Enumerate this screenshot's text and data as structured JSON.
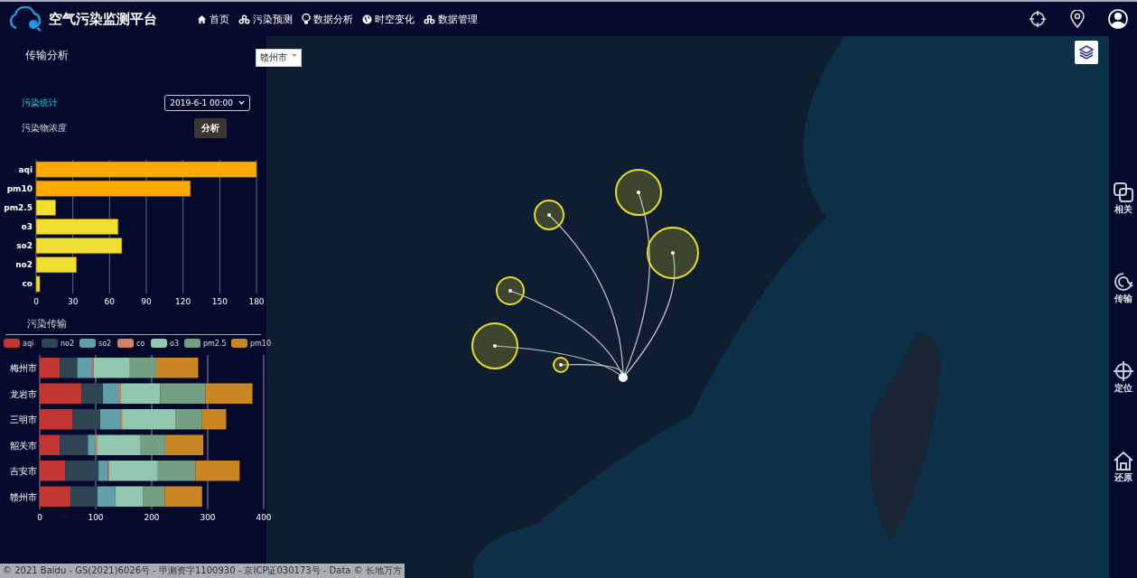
{
  "header": {
    "title": "空气污染监测平台",
    "nav": [
      {
        "label": "首页",
        "kind": "home"
      },
      {
        "label": "污染预测",
        "kind": "cluster"
      },
      {
        "label": "数据分析",
        "kind": "bulb"
      },
      {
        "label": "时空变化",
        "kind": "globe"
      },
      {
        "label": "数据管理",
        "kind": "cluster"
      }
    ]
  },
  "panel": {
    "title": "传输分析",
    "stats_label": "污染统计",
    "date_select": "2019-6-1 00:00",
    "concentration_label": "污染物浓度",
    "analyze_button": "分析",
    "chart_data": {
      "type": "bar",
      "orientation": "horizontal",
      "categories": [
        "aqi",
        "pm10",
        "pm2.5",
        "o3",
        "so2",
        "no2",
        "co"
      ],
      "values": [
        180,
        126,
        16,
        67,
        70,
        33,
        3
      ],
      "colors": [
        "#ffaa00",
        "#ffaa00",
        "#f0de30",
        "#f0de30",
        "#f0de30",
        "#f0de30",
        "#f0de30"
      ],
      "xlim": [
        0,
        180
      ],
      "xticks": [
        0,
        30,
        60,
        90,
        120,
        150,
        180
      ],
      "grid": true
    },
    "transport_title": "污染传输",
    "transport_chart": {
      "chart_data": {
        "type": "bar",
        "orientation": "horizontal",
        "stacked": true,
        "categories": [
          "梅州市",
          "龙岩市",
          "三明市",
          "韶关市",
          "吉安市",
          "赣州市"
        ],
        "xlim": [
          0,
          400
        ],
        "xticks": [
          0,
          100,
          200,
          300,
          400
        ],
        "grid": true,
        "legend": true,
        "series": [
          {
            "name": "aqi",
            "color": "#c23531",
            "values": [
              36,
              75,
              59,
              36,
              46,
              55
            ]
          },
          {
            "name": "no2",
            "color": "#2f4554",
            "values": [
              31,
              38,
              49,
              50,
              59,
              48
            ]
          },
          {
            "name": "so2",
            "color": "#61a0a8",
            "values": [
              27,
              29,
              37,
              13,
              17,
              32
            ]
          },
          {
            "name": "co",
            "color": "#d48265",
            "values": [
              2,
              3,
              2,
              3,
              2,
              null
            ]
          },
          {
            "name": "o3",
            "color": "#91c7ae",
            "values": [
              65,
              70,
              96,
              77,
              87,
              49
            ]
          },
          {
            "name": "pm2.5",
            "color": "#749f83",
            "values": [
              47,
              81,
              47,
              45,
              67,
              39
            ]
          },
          {
            "name": "pm10",
            "color": "#ca8622",
            "values": [
              75,
              84,
              43,
              68,
              79,
              67
            ]
          }
        ]
      }
    }
  },
  "map": {
    "city_select": "赣州市",
    "copyright": "© 2021 Baidu - GS(2021)6026号 - 甲测资字1100930 - 京ICP证030173号 - Data © 长地万方"
  },
  "sidebar": {
    "items": [
      {
        "label": "相关",
        "kind": "frames"
      },
      {
        "label": "传输",
        "kind": "spiral"
      },
      {
        "label": "定位",
        "kind": "crosshair"
      },
      {
        "label": "还原",
        "kind": "house"
      }
    ]
  }
}
